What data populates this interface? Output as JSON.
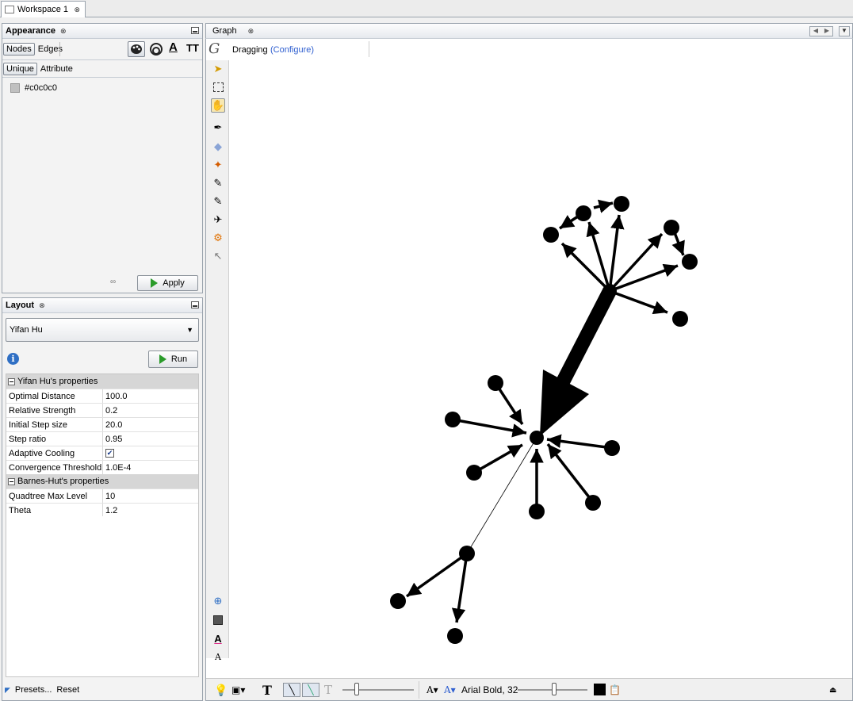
{
  "workspace": {
    "tab_label": "Workspace 1"
  },
  "appearance": {
    "title": "Appearance",
    "tabs": [
      "Nodes",
      "Edges"
    ],
    "modes": [
      "Unique",
      "Attribute"
    ],
    "color_value": "#c0c0c0",
    "apply_label": "Apply",
    "text_icon_a": "A",
    "text_icon_tt": "TT"
  },
  "layout": {
    "title": "Layout",
    "algorithm": "Yifan Hu",
    "run_label": "Run",
    "sections": [
      {
        "title": "Yifan Hu's properties"
      },
      {
        "title": "Barnes-Hut's properties"
      }
    ],
    "props": [
      {
        "key": "Optimal Distance",
        "value": "100.0"
      },
      {
        "key": "Relative Strength",
        "value": "0.2"
      },
      {
        "key": "Initial Step size",
        "value": "20.0"
      },
      {
        "key": "Step ratio",
        "value": "0.95"
      },
      {
        "key": "Adaptive Cooling",
        "value": "checked"
      },
      {
        "key": "Convergence Threshold",
        "value": "1.0E-4"
      },
      {
        "key": "Quadtree Max Level",
        "value": "10"
      },
      {
        "key": "Theta",
        "value": "1.2"
      }
    ],
    "presets_label": "Presets...",
    "reset_label": "Reset"
  },
  "graph": {
    "tab_label": "Graph",
    "mode_label": "Dragging",
    "configure_label": "(Configure)",
    "font_label": "Arial Bold, 32",
    "node_color": "#000000",
    "edge_color": "#000000",
    "text_a": "A",
    "text_t": "T"
  },
  "icons": {
    "close": "close-icon",
    "minimize": "minimize-icon",
    "info": "info-icon",
    "run": "play-icon",
    "dropdown": "chevron-down-icon"
  }
}
